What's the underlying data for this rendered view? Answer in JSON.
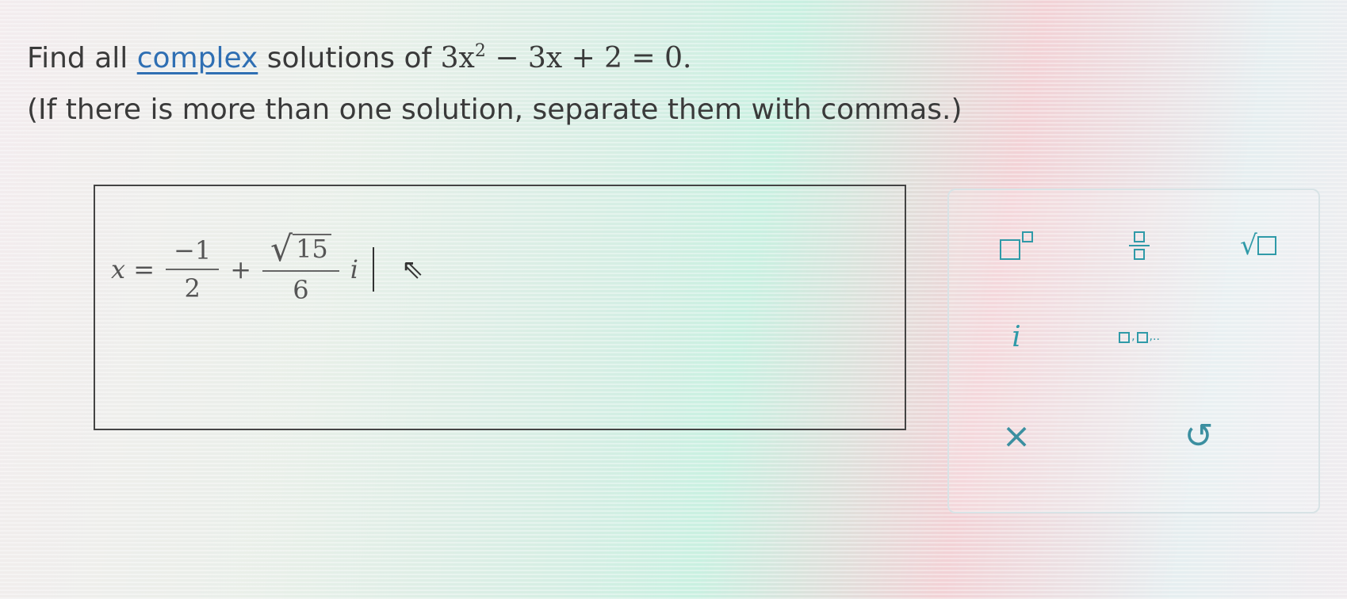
{
  "prompt": {
    "line1_prefix": "Find all",
    "line1_link": "complex",
    "line1_mid": "solutions of",
    "eq_coef": "3x",
    "eq_exp": "2",
    "eq_rest": " − 3x + 2 = 0.",
    "line2": "(If there is more than one solution, separate them with commas.)"
  },
  "answer": {
    "lhs": "x =",
    "frac1_num": "−1",
    "frac1_den": "2",
    "plus": "+",
    "sqrt_radicand": "15",
    "frac2_den": "6",
    "imag_unit": "i",
    "pointer": "⇖"
  },
  "palette": {
    "colors": {
      "accent": "#2f9aa8"
    },
    "buttons": [
      {
        "name": "superscript",
        "icon": "superscript-icon"
      },
      {
        "name": "fraction",
        "icon": "fraction-icon"
      },
      {
        "name": "square-root",
        "icon": "sqrt-icon"
      },
      {
        "name": "imaginary",
        "label": "i"
      },
      {
        "name": "list",
        "icon": "comma-list-icon"
      },
      {
        "name": "clear",
        "label": "×"
      },
      {
        "name": "undo",
        "label": "↺"
      }
    ]
  }
}
